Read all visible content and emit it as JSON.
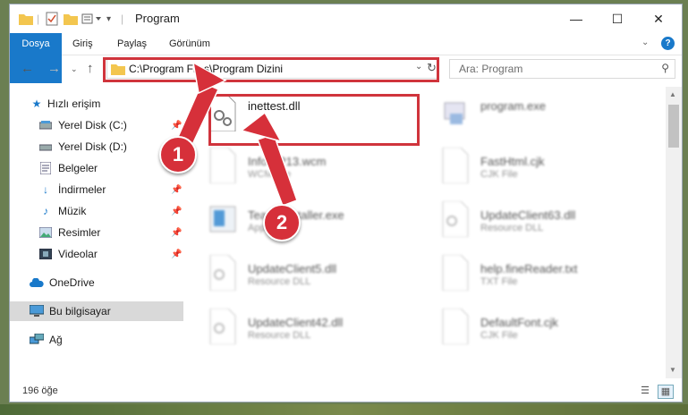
{
  "window": {
    "title": "Program",
    "controls": {
      "minimize": "—",
      "maximize": "☐",
      "close": "✕"
    }
  },
  "ribbon": {
    "tabs": [
      "Dosya",
      "Giriş",
      "Paylaş",
      "Görünüm"
    ]
  },
  "address_bar": {
    "path": "C:\\Program Files\\Program Dizini",
    "search_placeholder": "Ara: Program"
  },
  "sidebar": {
    "items": [
      {
        "label": "Hızlı erişim",
        "icon": "star-icon",
        "pinned": false
      },
      {
        "label": "Yerel Disk (C:)",
        "icon": "drive-icon",
        "pinned": true
      },
      {
        "label": "Yerel Disk (D:)",
        "icon": "drive-icon",
        "pinned": true
      },
      {
        "label": "Belgeler",
        "icon": "documents-icon",
        "pinned": true
      },
      {
        "label": "İndirmeler",
        "icon": "download-icon",
        "pinned": true
      },
      {
        "label": "Müzik",
        "icon": "music-icon",
        "pinned": true
      },
      {
        "label": "Resimler",
        "icon": "pictures-icon",
        "pinned": true
      },
      {
        "label": "Videolar",
        "icon": "videos-icon",
        "pinned": true
      },
      {
        "label": "OneDrive",
        "icon": "cloud-icon",
        "pinned": false
      },
      {
        "label": "Bu bilgisayar",
        "icon": "computer-icon",
        "pinned": false,
        "selected": true
      },
      {
        "label": "Ağ",
        "icon": "network-icon",
        "pinned": false
      }
    ]
  },
  "files": [
    {
      "name": "inettest.dll",
      "type": "",
      "highlighted": true
    },
    {
      "name": "program.exe",
      "type": ""
    },
    {
      "name": "InfoWP13.wcm",
      "type": "WCM File"
    },
    {
      "name": "FastHtml.cjk",
      "type": "CJK File"
    },
    {
      "name": "TeamsInstaller.exe",
      "type": "Application"
    },
    {
      "name": "UpdateClient63.dll",
      "type": "Resource DLL"
    },
    {
      "name": "UpdateClient5.dll",
      "type": "Resource DLL"
    },
    {
      "name": "help.fineReader.txt",
      "type": "TXT File"
    },
    {
      "name": "UpdateClient42.dll",
      "type": "Resource DLL"
    },
    {
      "name": "DefaultFont.cjk",
      "type": "CJK File"
    }
  ],
  "status_bar": {
    "item_count": "196 öğe"
  },
  "annotations": {
    "marker1": "1",
    "marker2": "2"
  },
  "colors": {
    "accent": "#1979ca",
    "highlight": "#d0343c"
  }
}
